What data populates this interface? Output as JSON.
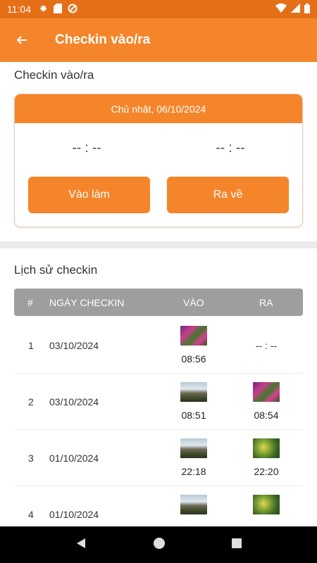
{
  "status_bar": {
    "time": "11:04"
  },
  "app_bar": {
    "title": "Checkin vào/ra"
  },
  "checkin": {
    "section_title": "Checkin vào/ra",
    "date": "Chủ nhật, 06/10/2024",
    "time_in": "-- : --",
    "time_out": "-- : --",
    "btn_in": "Vào làm",
    "btn_out": "Ra về"
  },
  "history": {
    "section_title": "Lịch sử checkin",
    "columns": [
      "#",
      "NGÀY CHECKIN",
      "VÀO",
      "RA"
    ],
    "rows": [
      {
        "idx": "1",
        "date": "03/10/2024",
        "in_time": "08:56",
        "in_photo": "flowers",
        "out_time": "-- : --",
        "out_photo": ""
      },
      {
        "idx": "2",
        "date": "03/10/2024",
        "in_time": "08:51",
        "in_photo": "coast",
        "out_time": "08:54",
        "out_photo": "flowers"
      },
      {
        "idx": "3",
        "date": "01/10/2024",
        "in_time": "22:18",
        "in_photo": "coast",
        "out_time": "22:20",
        "out_photo": "plant"
      },
      {
        "idx": "4",
        "date": "01/10/2024",
        "in_time": "",
        "in_photo": "coast",
        "out_time": "",
        "out_photo": "plant"
      }
    ]
  },
  "colors": {
    "primary": "#f5852a",
    "status_bar": "#e56f16",
    "table_header": "#9e9e9e"
  }
}
